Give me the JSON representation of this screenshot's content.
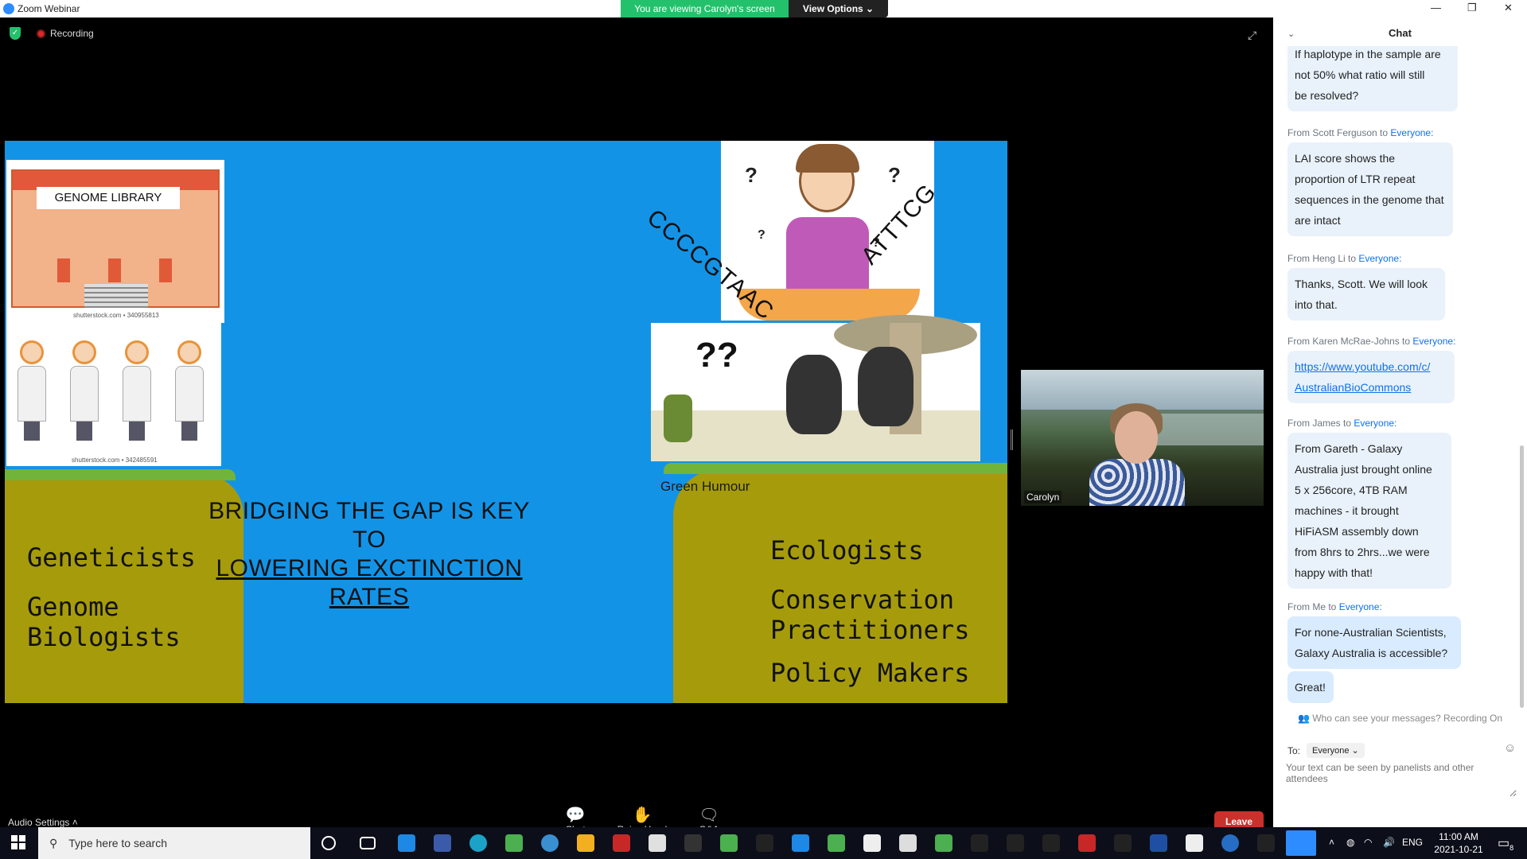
{
  "window": {
    "title": "Zoom Webinar",
    "viewing_banner": "You are viewing Carolyn's screen",
    "view_options": "View Options ⌄"
  },
  "meeting": {
    "recording_label": "Recording",
    "participant_name": "Carolyn"
  },
  "slide": {
    "library_label": "GENOME LIBRARY",
    "watermark_1": "shutterstock.com • 340955813",
    "watermark_2": "shutterstock.com • 342485591",
    "dna_left": "CCCCGTAAC",
    "dna_right": "ATTTCG",
    "bears_qq": "??",
    "bears_caption": "Green Humour",
    "headline_line1": "BRIDGING THE GAP IS KEY TO",
    "headline_line2": "LOWERING EXCTINCTION RATES",
    "left_labels": [
      "Geneticists",
      "Genome\nBiologists"
    ],
    "right_labels": [
      "Ecologists",
      "Conservation\nPractitioners",
      "Policy Makers"
    ]
  },
  "toolbar": {
    "audio_settings": "Audio Settings",
    "chat": "Chat",
    "raise_hand": "Raise Hand",
    "qa": "Q&A",
    "leave": "Leave"
  },
  "chat": {
    "header": "Chat",
    "messages": [
      {
        "from": "",
        "to": "",
        "text": "If haplotype in the sample are\nnot 50% what ratio will still\nbe resolved?"
      },
      {
        "from": "From Scott Ferguson to ",
        "to": "Everyone:",
        "text": "LAI score shows the\nproportion of LTR repeat\nsequences in the genome that\nare intact"
      },
      {
        "from": "From Heng Li to ",
        "to": "Everyone:",
        "text": "Thanks, Scott. We will look\ninto that."
      },
      {
        "from": "From Karen McRae-Johns to ",
        "to": "Everyone:",
        "text": "https://www.youtube.com/c/\nAustralianBioCommons"
      },
      {
        "from": "From James to ",
        "to": "Everyone:",
        "text": "From Gareth - Galaxy\nAustralia just brought online\n5 x 256core, 4TB RAM\nmachines - it brought\nHiFiASM assembly down\nfrom 8hrs to 2hrs...we were\nhappy with that!"
      },
      {
        "from": "From Me to ",
        "to": "Everyone:",
        "text": "For none-Australian Scientists,\nGalaxy Australia is accessible?"
      },
      {
        "from": "",
        "to": "",
        "text": "Great!"
      }
    ],
    "privacy_note": "Who can see your messages? Recording On",
    "to_label": "To:",
    "to_value": "Everyone ⌄",
    "input_placeholder": "Your text can be seen by panelists and other attendees"
  },
  "taskbar": {
    "search_placeholder": "Type here to search",
    "language": "ENG",
    "time": "11:00 AM",
    "date": "2021-10-21",
    "notifications": "8"
  },
  "colors": {
    "slide_sky": "#1393e6",
    "cliff": "#a69b0b",
    "leave": "#c9312b",
    "zoom_blue": "#0e71eb",
    "banner_green": "#23c16b"
  }
}
